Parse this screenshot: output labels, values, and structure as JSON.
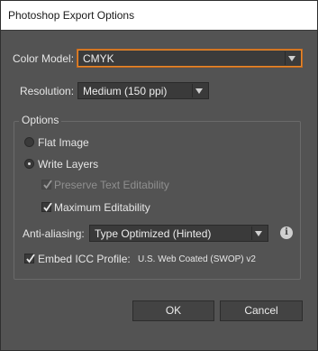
{
  "window": {
    "title": "Photoshop Export Options"
  },
  "color_model": {
    "label": "Color Model:",
    "value": "CMYK"
  },
  "resolution": {
    "label": "Resolution:",
    "value": "Medium (150 ppi)"
  },
  "options": {
    "label": "Options",
    "flat_image": {
      "label": "Flat Image",
      "selected": false
    },
    "write_layers": {
      "label": "Write Layers",
      "selected": true
    },
    "preserve_text": {
      "label": "Preserve Text Editability",
      "checked": true,
      "enabled": false
    },
    "max_editability": {
      "label": "Maximum Editability",
      "checked": true,
      "enabled": true
    },
    "anti_aliasing": {
      "label": "Anti-aliasing:",
      "value": "Type Optimized (Hinted)"
    },
    "embed_icc": {
      "label": "Embed ICC Profile:",
      "checked": true,
      "profile": "U.S. Web Coated (SWOP) v2"
    },
    "info_icon": "i"
  },
  "buttons": {
    "ok": "OK",
    "cancel": "Cancel"
  },
  "colors": {
    "focus": "#e8872c",
    "panel": "#535353",
    "field": "#3a3a3a"
  }
}
